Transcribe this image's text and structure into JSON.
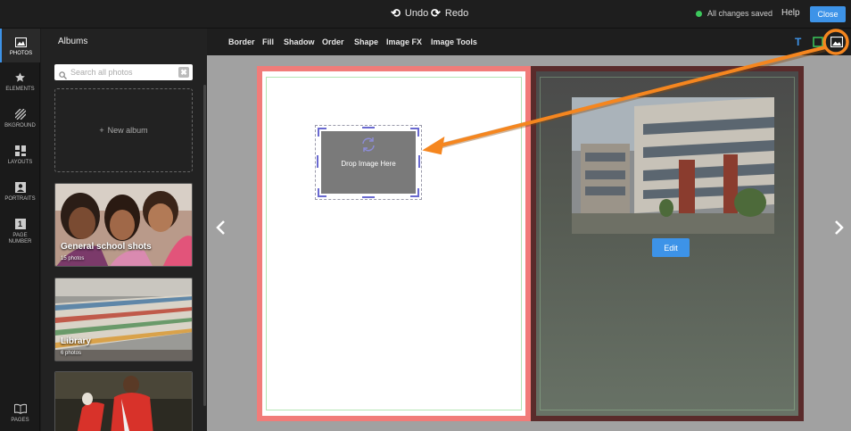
{
  "topbar": {
    "undo_label": "Undo",
    "redo_label": "Redo",
    "status": "All changes saved",
    "help_label": "Help",
    "close_label": "Close"
  },
  "rail": {
    "items": [
      {
        "label": "PHOTOS",
        "icon": "photos-icon"
      },
      {
        "label": "ELEMENTS",
        "icon": "star-icon"
      },
      {
        "label": "BKGROUND",
        "icon": "background-icon"
      },
      {
        "label": "LAYOUTS",
        "icon": "layouts-icon"
      },
      {
        "label": "PORTRAITS",
        "icon": "portrait-icon"
      },
      {
        "label": "PAGE NUMBER",
        "icon": "page-number-icon",
        "glyph": "1"
      },
      {
        "label": "PAGES",
        "icon": "book-icon"
      }
    ]
  },
  "panel": {
    "title": "Albums",
    "search_placeholder": "Search all photos",
    "clear_glyph": "✖",
    "new_album_label": "New album",
    "albums": [
      {
        "name": "General school shots",
        "count": "15 photos"
      },
      {
        "name": "Library",
        "count": "6 photos"
      },
      {
        "name": "",
        "count": ""
      }
    ]
  },
  "toolbar": {
    "tools": [
      "Border",
      "Fill",
      "Shadow",
      "Order",
      "Shape",
      "Image FX",
      "Image Tools"
    ],
    "text_tool_glyph": "T"
  },
  "canvas": {
    "drop_label": "Drop Image Here",
    "edit_label": "Edit"
  },
  "colors": {
    "accent": "#3d93e8",
    "callout": "#f5861f",
    "page_border_left": "#f17c79",
    "page_border_right": "#5a2b2b",
    "saved_dot": "#3cc85c"
  }
}
